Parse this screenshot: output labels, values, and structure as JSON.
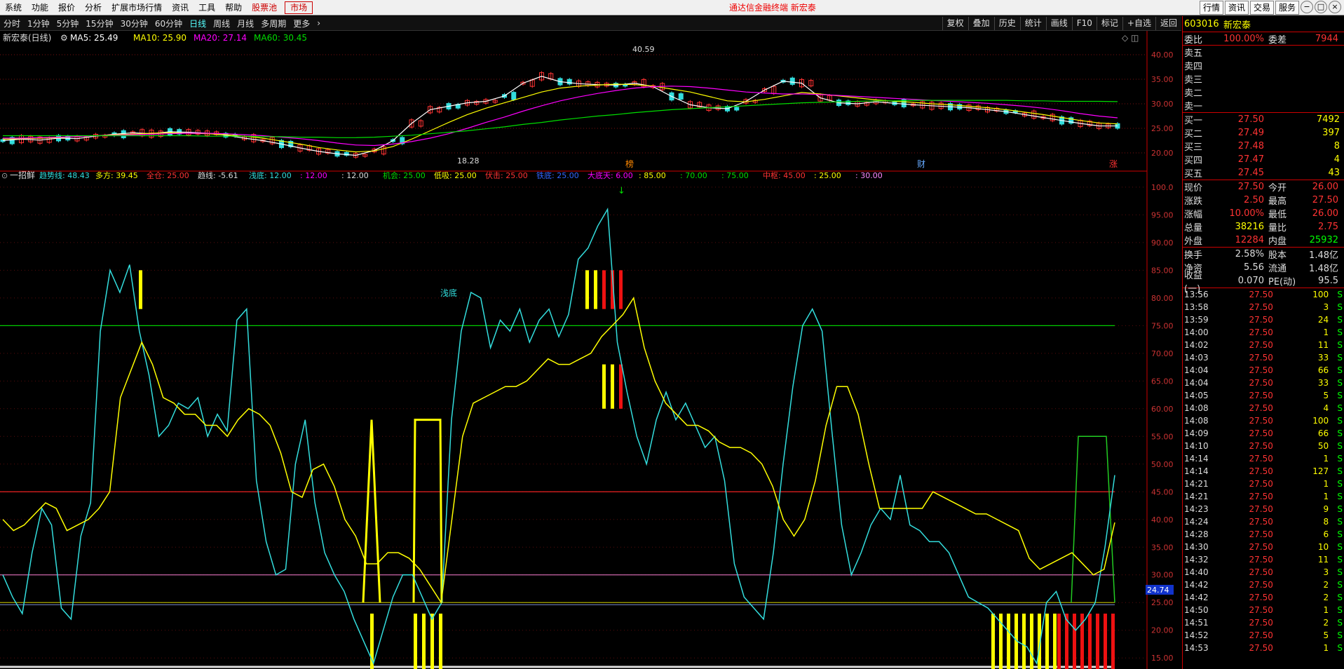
{
  "menubar": {
    "items": [
      "系统",
      "功能",
      "报价",
      "分析",
      "扩展市场行情",
      "资讯",
      "工具",
      "帮助"
    ],
    "highlight": "股票池",
    "boxed": "市场",
    "center_text": "通达信金融终端  新宏泰",
    "right_buttons": [
      "行情",
      "资讯",
      "交易",
      "服务"
    ],
    "window_buttons": [
      "−",
      "□",
      "×"
    ]
  },
  "toolbar": {
    "periods": [
      "分时",
      "1分钟",
      "5分钟",
      "15分钟",
      "30分钟",
      "60分钟",
      "日线",
      "周线",
      "月线",
      "多周期",
      "更多"
    ],
    "active": "日线",
    "right_buttons": [
      "复权",
      "叠加",
      "历史",
      "统计",
      "画线",
      "F10",
      "标记",
      "+自选",
      "返回"
    ]
  },
  "main_chart": {
    "legend": {
      "name": "新宏泰(日线)",
      "ma": [
        {
          "label": "MA5: 25.49",
          "color": "#ffffff"
        },
        {
          "label": "MA10: 25.90",
          "color": "#ffff00"
        },
        {
          "label": "MA20: 27.14",
          "color": "#ff00ff"
        },
        {
          "label": "MA60: 30.45",
          "color": "#00dd00"
        }
      ]
    },
    "y_ticks": [
      "40.00",
      "35.00",
      "30.00",
      "25.00",
      "20.00"
    ],
    "high_label": "40.59",
    "low_label": "18.28",
    "markers": [
      {
        "text": "榜",
        "color": "#ff8800"
      },
      {
        "text": "财",
        "color": "#66aaff"
      },
      {
        "text": "涨",
        "color": "#ff3333"
      }
    ]
  },
  "indicator": {
    "title": "一招鲜",
    "items": [
      {
        "text": "趋势线: 48.43",
        "color": "#33dddd"
      },
      {
        "text": "多方: 39.45",
        "color": "#ffff00"
      },
      {
        "text": "全仓: 25.00",
        "color": "#ff3333"
      },
      {
        "text": "趋线: -5.61",
        "color": "#dddddd"
      },
      {
        "text": "浅底: 12.00",
        "color": "#33dddd"
      },
      {
        "text": ": 12.00",
        "color": "#ff00ff"
      },
      {
        "text": ": 12.00",
        "color": "#dddddd"
      },
      {
        "text": "机会: 25.00",
        "color": "#00dd00"
      },
      {
        "text": "低吸: 25.00",
        "color": "#ffff00"
      },
      {
        "text": "伏击: 25.00",
        "color": "#ff3333"
      },
      {
        "text": "铁底: 25.00",
        "color": "#3366ff"
      },
      {
        "text": "大底天: 6.00",
        "color": "#ff00ff"
      },
      {
        "text": ": 85.00",
        "color": "#ffff00"
      },
      {
        "text": ": 70.00",
        "color": "#00dd00"
      },
      {
        "text": ": 75.00",
        "color": "#00dd00"
      },
      {
        "text": "中枢: 45.00",
        "color": "#ff3333"
      },
      {
        "text": ": 25.00",
        "color": "#ffff00"
      },
      {
        "text": ": 30.00",
        "color": "#ff88ff"
      }
    ],
    "y_ticks": [
      "100.0",
      "95.00",
      "90.00",
      "85.00",
      "80.00",
      "75.00",
      "70.00",
      "65.00",
      "60.00",
      "55.00",
      "50.00",
      "45.00",
      "40.00",
      "35.00",
      "30.00",
      "25.00",
      "20.00",
      "15.00"
    ],
    "current_value": "24.74",
    "annotation": "浅底",
    "signal_arrow": "↓"
  },
  "quote": {
    "code": "603016",
    "name": "新宏泰",
    "webi": {
      "label": "委比",
      "value": "100.00%",
      "label2": "委差",
      "value2": "7944"
    },
    "sells": [
      {
        "label": "卖五",
        "price": "",
        "vol": ""
      },
      {
        "label": "卖四",
        "price": "",
        "vol": ""
      },
      {
        "label": "卖三",
        "price": "",
        "vol": ""
      },
      {
        "label": "卖二",
        "price": "",
        "vol": ""
      },
      {
        "label": "卖一",
        "price": "",
        "vol": ""
      }
    ],
    "buys": [
      {
        "label": "买一",
        "price": "27.50",
        "vol": "7492"
      },
      {
        "label": "买二",
        "price": "27.49",
        "vol": "397"
      },
      {
        "label": "买三",
        "price": "27.48",
        "vol": "8"
      },
      {
        "label": "买四",
        "price": "27.47",
        "vol": "4"
      },
      {
        "label": "买五",
        "price": "27.45",
        "vol": "43"
      }
    ],
    "stats": [
      {
        "l": "现价",
        "v": "27.50",
        "vc": "red",
        "l2": "今开",
        "v2": "26.00",
        "v2c": "red"
      },
      {
        "l": "涨跌",
        "v": "2.50",
        "vc": "red",
        "l2": "最高",
        "v2": "27.50",
        "v2c": "red"
      },
      {
        "l": "涨幅",
        "v": "10.00%",
        "vc": "red",
        "l2": "最低",
        "v2": "26.00",
        "v2c": "red"
      },
      {
        "l": "总量",
        "v": "38216",
        "vc": "yellow",
        "l2": "量比",
        "v2": "2.75",
        "v2c": "red"
      },
      {
        "l": "外盘",
        "v": "12284",
        "vc": "red",
        "l2": "内盘",
        "v2": "25932",
        "v2c": "green"
      }
    ],
    "stats2": [
      {
        "l": "换手",
        "v": "2.58%",
        "vc": "white",
        "l2": "股本",
        "v2": "1.48亿",
        "v2c": "white"
      },
      {
        "l": "净资",
        "v": "5.56",
        "vc": "white",
        "l2": "流通",
        "v2": "1.48亿",
        "v2c": "white"
      },
      {
        "l": "收益(一)",
        "v": "0.070",
        "vc": "white",
        "l2": "PE(动)",
        "v2": "95.5",
        "v2c": "white"
      }
    ],
    "ticks": [
      {
        "t": "13:56",
        "p": "27.50",
        "v": "100",
        "s": "S"
      },
      {
        "t": "13:58",
        "p": "27.50",
        "v": "3",
        "s": "S"
      },
      {
        "t": "13:59",
        "p": "27.50",
        "v": "24",
        "s": "S"
      },
      {
        "t": "14:00",
        "p": "27.50",
        "v": "1",
        "s": "S"
      },
      {
        "t": "14:02",
        "p": "27.50",
        "v": "11",
        "s": "S"
      },
      {
        "t": "14:03",
        "p": "27.50",
        "v": "33",
        "s": "S"
      },
      {
        "t": "14:04",
        "p": "27.50",
        "v": "66",
        "s": "S"
      },
      {
        "t": "14:04",
        "p": "27.50",
        "v": "33",
        "s": "S"
      },
      {
        "t": "14:05",
        "p": "27.50",
        "v": "5",
        "s": "S"
      },
      {
        "t": "14:08",
        "p": "27.50",
        "v": "4",
        "s": "S"
      },
      {
        "t": "14:08",
        "p": "27.50",
        "v": "100",
        "s": "S"
      },
      {
        "t": "14:09",
        "p": "27.50",
        "v": "66",
        "s": "S"
      },
      {
        "t": "14:10",
        "p": "27.50",
        "v": "50",
        "s": "S"
      },
      {
        "t": "14:14",
        "p": "27.50",
        "v": "1",
        "s": "S"
      },
      {
        "t": "14:14",
        "p": "27.50",
        "v": "127",
        "s": "S"
      },
      {
        "t": "14:21",
        "p": "27.50",
        "v": "1",
        "s": "S"
      },
      {
        "t": "14:21",
        "p": "27.50",
        "v": "1",
        "s": "S"
      },
      {
        "t": "14:23",
        "p": "27.50",
        "v": "9",
        "s": "S"
      },
      {
        "t": "14:24",
        "p": "27.50",
        "v": "8",
        "s": "S"
      },
      {
        "t": "14:28",
        "p": "27.50",
        "v": "6",
        "s": "S"
      },
      {
        "t": "14:30",
        "p": "27.50",
        "v": "10",
        "s": "S"
      },
      {
        "t": "14:32",
        "p": "27.50",
        "v": "11",
        "s": "S"
      },
      {
        "t": "14:40",
        "p": "27.50",
        "v": "3",
        "s": "S"
      },
      {
        "t": "14:42",
        "p": "27.50",
        "v": "2",
        "s": "S"
      },
      {
        "t": "14:42",
        "p": "27.50",
        "v": "2",
        "s": "S"
      },
      {
        "t": "14:50",
        "p": "27.50",
        "v": "1",
        "s": "S"
      },
      {
        "t": "14:51",
        "p": "27.50",
        "v": "2",
        "s": "S"
      },
      {
        "t": "14:52",
        "p": "27.50",
        "v": "5",
        "s": "S"
      },
      {
        "t": "14:53",
        "p": "27.50",
        "v": "1",
        "s": "S"
      }
    ]
  },
  "chart_data": [
    {
      "type": "line",
      "title": "新宏泰(日线)",
      "ylim": [
        17,
        42
      ],
      "series": [
        {
          "name": "MA5",
          "color": "#ffffff",
          "values": [
            22.5,
            22.8,
            22.6,
            23.0,
            22.9,
            23.4,
            23.8,
            24.1,
            23.9,
            24.3,
            24.2,
            24.0,
            23.6,
            23.0,
            22.5,
            21.8,
            21.0,
            20.3,
            19.8,
            19.5,
            20.5,
            22.5,
            26.0,
            28.8,
            29.5,
            30.2,
            30.5,
            31.6,
            34.2,
            35.6,
            34.5,
            34.1,
            33.9,
            33.8,
            34.2,
            33.5,
            31.5,
            29.8,
            29.2,
            29.0,
            30.5,
            32.8,
            34.6,
            34.2,
            31.2,
            30.2,
            30.0,
            30.4,
            30.1,
            29.8,
            29.6,
            29.4,
            29.2,
            28.8,
            28.4,
            27.8,
            27.2,
            26.6,
            26.0,
            25.5,
            25.49
          ]
        },
        {
          "name": "MA10",
          "color": "#ffff00",
          "values": [
            22.8,
            22.9,
            23.0,
            23.1,
            23.3,
            23.5,
            23.7,
            23.8,
            24.0,
            24.1,
            24.0,
            23.9,
            23.7,
            23.4,
            23.0,
            22.4,
            21.8,
            21.1,
            20.6,
            20.2,
            20.4,
            21.3,
            22.8,
            24.5,
            26.2,
            27.8,
            29.1,
            30.2,
            31.3,
            32.4,
            33.2,
            33.6,
            33.8,
            34.0,
            33.9,
            33.6,
            33.0,
            32.4,
            31.5,
            30.6,
            30.4,
            30.9,
            31.6,
            32.3,
            32.0,
            31.6,
            31.2,
            30.8,
            30.5,
            30.3,
            30.0,
            29.8,
            29.5,
            29.2,
            28.8,
            28.3,
            27.8,
            27.2,
            26.6,
            26.1,
            25.9
          ]
        },
        {
          "name": "MA20",
          "color": "#ff00ff",
          "values": [
            23.0,
            23.0,
            23.1,
            23.2,
            23.3,
            23.5,
            23.6,
            23.7,
            23.8,
            23.9,
            24.0,
            24.0,
            23.9,
            23.7,
            23.5,
            23.2,
            22.9,
            22.5,
            22.0,
            21.6,
            21.5,
            21.8,
            22.3,
            23.0,
            23.9,
            25.0,
            26.2,
            27.3,
            28.5,
            29.6,
            30.6,
            31.4,
            32.1,
            32.7,
            33.2,
            33.5,
            33.6,
            33.5,
            33.2,
            32.8,
            32.4,
            32.2,
            32.0,
            32.0,
            31.9,
            31.7,
            31.5,
            31.3,
            31.1,
            30.9,
            30.7,
            30.5,
            30.3,
            30.1,
            29.8,
            29.5,
            29.1,
            28.6,
            28.0,
            27.5,
            27.14
          ]
        },
        {
          "name": "MA60",
          "color": "#00dd00",
          "values": [
            23.5,
            23.5,
            23.5,
            23.5,
            23.5,
            23.5,
            23.5,
            23.5,
            23.5,
            23.5,
            23.5,
            23.4,
            23.4,
            23.4,
            23.3,
            23.3,
            23.2,
            23.2,
            23.1,
            23.1,
            23.2,
            23.4,
            23.6,
            23.9,
            24.2,
            24.5,
            24.9,
            25.3,
            25.8,
            26.2,
            26.7,
            27.1,
            27.5,
            27.8,
            28.2,
            28.5,
            28.8,
            29.0,
            29.2,
            29.4,
            29.6,
            29.8,
            30.0,
            30.2,
            30.3,
            30.4,
            30.5,
            30.6,
            30.6,
            30.7,
            30.7,
            30.7,
            30.7,
            30.7,
            30.7,
            30.6,
            30.6,
            30.5,
            30.5,
            30.5,
            30.45
          ]
        }
      ]
    },
    {
      "type": "line",
      "title": "一招鲜",
      "ylim": [
        13,
        101
      ],
      "series": [
        {
          "name": "趋势线",
          "color": "#33dddd",
          "values": [
            30,
            26,
            23,
            34,
            42,
            39,
            24,
            22,
            37,
            43,
            74,
            85,
            81,
            86,
            74,
            66,
            55,
            57,
            61,
            60,
            62,
            55,
            59,
            56,
            76,
            78,
            47,
            36,
            30,
            31,
            50,
            58,
            43,
            34,
            30,
            27,
            22,
            18,
            14,
            20,
            26,
            30,
            30,
            26,
            22,
            25,
            58,
            74,
            81,
            80,
            71,
            76,
            74,
            78,
            72,
            76,
            78,
            73,
            77,
            87,
            89,
            93,
            96,
            72,
            63,
            55,
            50,
            58,
            63,
            58,
            61,
            57,
            53,
            55,
            47,
            32,
            26,
            24,
            22,
            34,
            50,
            64,
            75,
            78,
            74,
            56,
            39,
            30,
            34,
            39,
            42,
            40,
            48,
            39,
            38,
            36,
            36,
            34,
            30,
            26,
            25,
            24,
            22,
            20,
            18,
            17,
            14,
            25,
            27,
            22,
            20,
            22,
            25,
            35,
            48
          ]
        },
        {
          "name": "多方",
          "color": "#ffff00",
          "values": [
            40,
            38,
            39,
            41,
            43,
            42,
            38,
            39,
            40,
            42,
            45,
            62,
            67,
            72,
            68,
            62,
            61,
            59,
            59,
            57,
            57,
            55,
            58,
            60,
            59,
            57,
            52,
            45,
            44,
            49,
            50,
            46,
            40,
            37,
            32,
            32,
            34,
            34,
            33,
            31,
            28,
            25,
            40,
            55,
            61,
            62,
            63,
            64,
            64,
            65,
            67,
            69,
            68,
            68,
            69,
            70,
            73,
            75,
            77,
            80,
            71,
            65,
            61,
            59,
            57,
            57,
            56,
            54,
            53,
            53,
            52,
            50,
            46,
            40,
            37,
            40,
            47,
            57,
            64,
            64,
            59,
            50,
            42,
            42,
            42,
            42,
            42,
            45,
            44,
            43,
            42,
            41,
            41,
            40,
            39,
            38,
            33,
            31,
            32,
            33,
            34,
            32,
            30,
            31,
            39.45
          ]
        }
      ]
    }
  ]
}
